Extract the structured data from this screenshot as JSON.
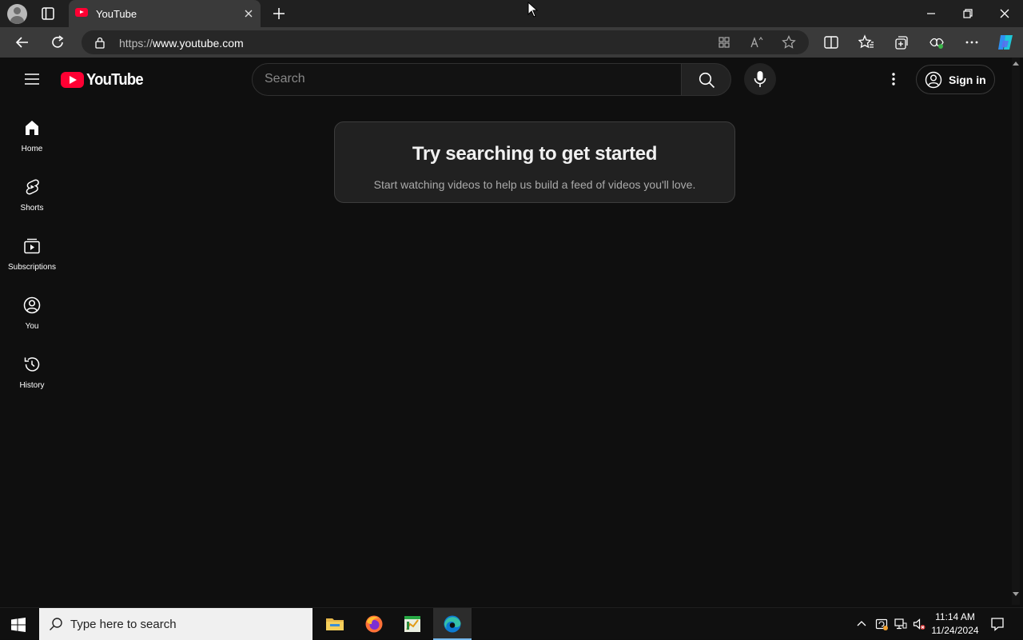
{
  "browser": {
    "tab_title": "YouTube",
    "url_protocol": "https://",
    "url_host": "www.youtube.com"
  },
  "header": {
    "logo_text": "YouTube",
    "search_placeholder": "Search",
    "signin_label": "Sign in"
  },
  "sidebar": {
    "items": [
      {
        "label": "Home",
        "icon": "home-icon"
      },
      {
        "label": "Shorts",
        "icon": "shorts-icon"
      },
      {
        "label": "Subscriptions",
        "icon": "subscriptions-icon"
      },
      {
        "label": "You",
        "icon": "you-icon"
      },
      {
        "label": "History",
        "icon": "history-icon"
      }
    ]
  },
  "main": {
    "title": "Try searching to get started",
    "subtitle": "Start watching videos to help us build a feed of videos you'll love."
  },
  "taskbar": {
    "search_placeholder": "Type here to search",
    "time": "11:14 AM",
    "date": "11/24/2024"
  },
  "colors": {
    "youtube_red": "#ff0033",
    "page_bg": "#0f0f0f",
    "accent_blue": "#76b9ed"
  }
}
